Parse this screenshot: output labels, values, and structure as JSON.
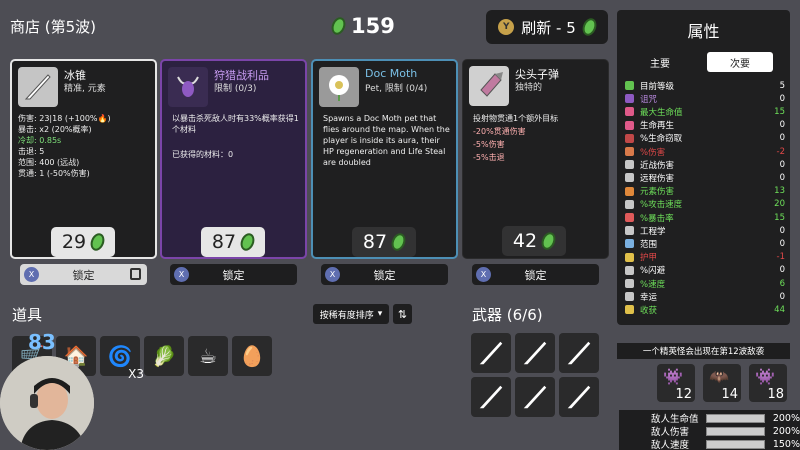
{
  "header": {
    "shop_title": "商店 (第5波)",
    "money": "159",
    "reroll_label": "刷新 - 5",
    "reroll_key": "Y"
  },
  "colors": {
    "money_green": "#62c250",
    "legendary": "#7b45a9",
    "pet_border": "#4d8fb5"
  },
  "cards": [
    {
      "name": "冰锥",
      "subtitle": "精准, 元素",
      "icon": "ice-spike-icon",
      "stats": [
        "伤害: 23|18 (+100%🔥)",
        "暴击: x2 (20%概率)",
        "冷却: 0.85s",
        "击退: 5",
        "范围: 400 (远战)",
        "贯通: 1 (-50%伤害)"
      ],
      "price": "29",
      "lock_label": "锁定",
      "lock_key": "X"
    },
    {
      "name": "狩猎战利品",
      "subtitle": "限制 (0/3)",
      "icon": "trophy-skull-icon",
      "description": "以暴击杀死敌人时有33%概率获得1个材料",
      "extra": "已获得的材料：0",
      "price": "87",
      "lock_label": "锁定",
      "lock_key": "X"
    },
    {
      "name": "Doc Moth",
      "subtitle": "Pet, 限制 (0/4)",
      "icon": "moth-flower-icon",
      "description": "Spawns a Doc Moth pet that flies around the map. When the player is inside its aura, their HP regeneration and Life Steal are doubled",
      "price": "87",
      "lock_label": "锁定",
      "lock_key": "X"
    },
    {
      "name": "尖头子弹",
      "subtitle": "独特的",
      "icon": "pointed-bullet-icon",
      "lines": [
        "投射物贯通1个额外目标",
        "-20%贯通伤害",
        "-5%伤害",
        "-5%击退"
      ],
      "price": "42",
      "lock_label": "锁定",
      "lock_key": "X"
    }
  ],
  "items_section": {
    "title": "道具",
    "sort_label": "按稀有度排序",
    "hp_overlay": "83",
    "items": [
      {
        "icon": "wheelbarrow-icon"
      },
      {
        "icon": "tree-house-icon"
      },
      {
        "icon": "coil-icon",
        "count": "X3"
      },
      {
        "icon": "cabbage-icon"
      },
      {
        "icon": "coffee-cup-icon"
      },
      {
        "icon": "egg-icon"
      }
    ]
  },
  "weapons_section": {
    "title": "武器 (6/6)",
    "weapons": [
      {
        "icon": "ice-spike-icon"
      },
      {
        "icon": "ice-spike-icon"
      },
      {
        "icon": "ice-spike-icon"
      },
      {
        "icon": "ice-spike-icon"
      },
      {
        "icon": "ice-spike-icon"
      },
      {
        "icon": "ice-spike-icon"
      }
    ]
  },
  "stats_panel": {
    "title": "属性",
    "tab_primary": "主要",
    "tab_secondary": "次要",
    "rows": [
      {
        "name": "目前等级",
        "value": "5",
        "name_color": "#ffffff",
        "value_color": "#ffffff",
        "icon_color": "#62c250"
      },
      {
        "name": "诅咒",
        "value": "0",
        "name_color": "#b98ae0",
        "value_color": "#ffffff",
        "icon_color": "#8e5ac2"
      },
      {
        "name": "最大生命值",
        "value": "15",
        "name_color": "#6ee05a",
        "value_color": "#6ee05a",
        "icon_color": "#e05a8a"
      },
      {
        "name": "生命再生",
        "value": "0",
        "name_color": "#ffffff",
        "value_color": "#ffffff",
        "icon_color": "#e05a8a"
      },
      {
        "name": "%生命窃取",
        "value": "0",
        "name_color": "#ffffff",
        "value_color": "#ffffff",
        "icon_color": "#c04848"
      },
      {
        "name": "%伤害",
        "value": "-2",
        "name_color": "#e04848",
        "value_color": "#e04848",
        "icon_color": "#d97a4a"
      },
      {
        "name": "近战伤害",
        "value": "0",
        "name_color": "#ffffff",
        "value_color": "#ffffff",
        "icon_color": "#c7c7c7"
      },
      {
        "name": "远程伤害",
        "value": "0",
        "name_color": "#ffffff",
        "value_color": "#ffffff",
        "icon_color": "#c7c7c7"
      },
      {
        "name": "元素伤害",
        "value": "13",
        "name_color": "#6ee05a",
        "value_color": "#6ee05a",
        "icon_color": "#e0883a"
      },
      {
        "name": "%攻击速度",
        "value": "20",
        "name_color": "#6ee05a",
        "value_color": "#6ee05a",
        "icon_color": "#c7c7c7"
      },
      {
        "name": "%暴击率",
        "value": "15",
        "name_color": "#6ee05a",
        "value_color": "#6ee05a",
        "icon_color": "#e05a5a"
      },
      {
        "name": "工程学",
        "value": "0",
        "name_color": "#ffffff",
        "value_color": "#ffffff",
        "icon_color": "#c7c7c7"
      },
      {
        "name": "范围",
        "value": "0",
        "name_color": "#ffffff",
        "value_color": "#ffffff",
        "icon_color": "#7ab0e0"
      },
      {
        "name": "护甲",
        "value": "-1",
        "name_color": "#e04848",
        "value_color": "#e04848",
        "icon_color": "#e0c04a"
      },
      {
        "name": "%闪避",
        "value": "0",
        "name_color": "#ffffff",
        "value_color": "#ffffff",
        "icon_color": "#c7c7c7"
      },
      {
        "name": "%速度",
        "value": "6",
        "name_color": "#6ee05a",
        "value_color": "#6ee05a",
        "icon_color": "#c7c7c7"
      },
      {
        "name": "幸运",
        "value": "0",
        "name_color": "#ffffff",
        "value_color": "#ffffff",
        "icon_color": "#c7c7c7"
      },
      {
        "name": "收获",
        "value": "44",
        "name_color": "#6ee05a",
        "value_color": "#6ee05a",
        "icon_color": "#e0c04a"
      }
    ]
  },
  "wave_info": {
    "message": "一个精英怪会出现在第12波敌袭",
    "enemies": [
      {
        "icon": "elite-horned-icon",
        "wave": "12"
      },
      {
        "icon": "elite-swarm-icon",
        "wave": "14"
      },
      {
        "icon": "elite-horned-icon",
        "wave": "18"
      }
    ]
  },
  "enemy_stats": [
    {
      "label": "敌人生命值",
      "percent": "200%"
    },
    {
      "label": "敌人伤害",
      "percent": "200%"
    },
    {
      "label": "敌人速度",
      "percent": "150%"
    }
  ]
}
